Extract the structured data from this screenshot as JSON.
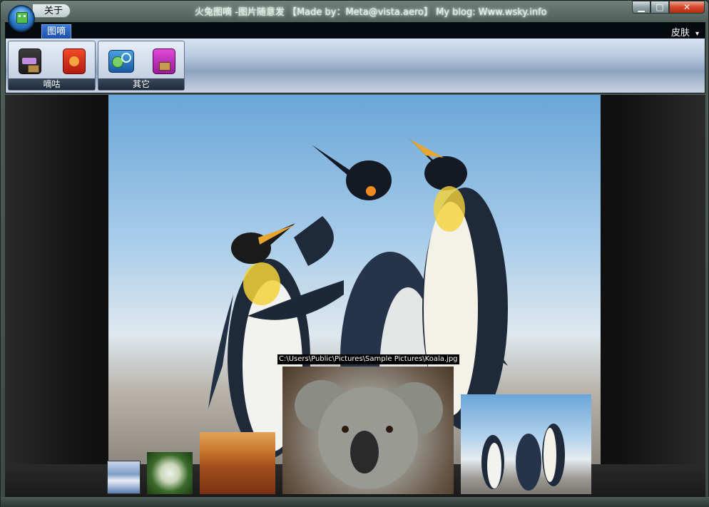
{
  "window": {
    "title": "火兔图嘀  -图片随意发 【Made by：Meta@vista.aero】 My blog: Www.wsky.info",
    "about_label": "关于",
    "controls": {
      "minimize": "▁",
      "maximize": "□",
      "close": "✕"
    }
  },
  "ribbon": {
    "tab_label": "图嘀",
    "skin_label": "皮肤",
    "skin_caret": "▾",
    "groups": [
      {
        "label": "嘀咕",
        "buttons": [
          "bag-icon",
          "red-person-icon"
        ]
      },
      {
        "label": "其它",
        "buttons": [
          "globe-people-icon",
          "pink-person-icon"
        ]
      }
    ]
  },
  "viewer": {
    "hover_path": "C:\\Users\\Public\\Pictures\\Sample Pictures\\Koala.jpg"
  }
}
